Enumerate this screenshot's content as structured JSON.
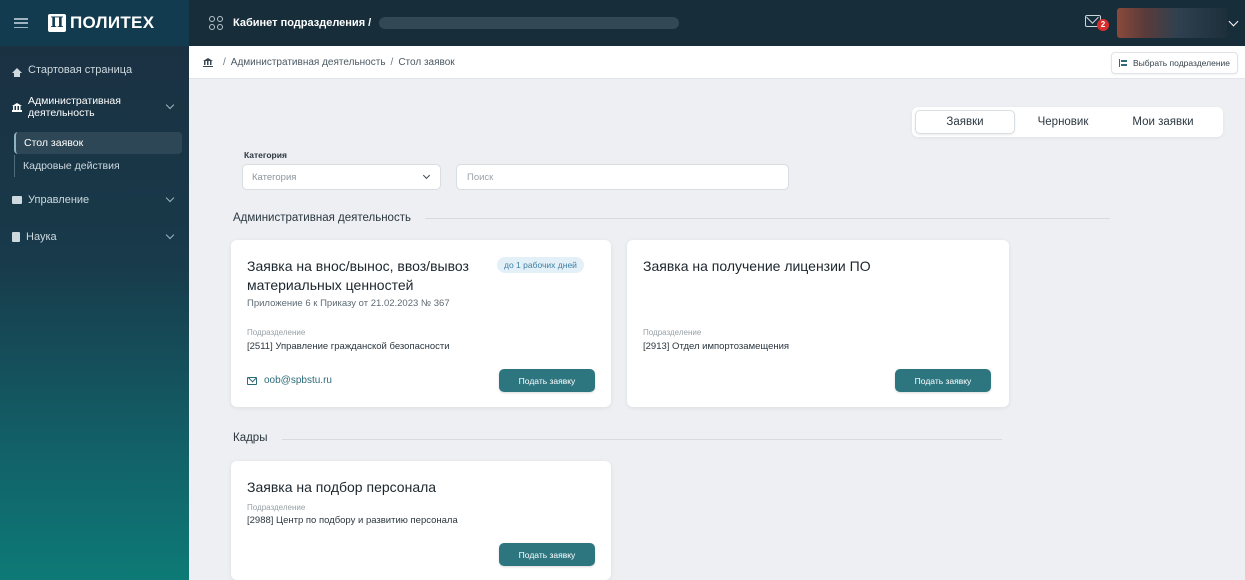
{
  "app": {
    "logo_text": "ПОЛИТЕХ",
    "logo_mark": "П",
    "cabinet_title": "Кабинет подразделения /",
    "mail_count": "2"
  },
  "sidebar": {
    "items": [
      {
        "label": "Стартовая страница",
        "icon": "home-icon"
      },
      {
        "label": "Административная деятельность",
        "icon": "bank-icon",
        "expanded": true
      },
      {
        "label": "Управление",
        "icon": "briefcase-icon"
      },
      {
        "label": "Наука",
        "icon": "book-icon"
      }
    ],
    "subitems": [
      {
        "label": "Стол заявок",
        "active": true
      },
      {
        "label": "Кадровые действия",
        "active": false
      }
    ]
  },
  "breadcrumb": {
    "items": [
      "Административная деятельность",
      "Стол заявок"
    ],
    "select_unit_label": "Выбрать подразделение"
  },
  "tabs": [
    {
      "label": "Заявки",
      "active": true
    },
    {
      "label": "Черновик",
      "active": false
    },
    {
      "label": "Мои заявки",
      "active": false
    }
  ],
  "filters": {
    "category_label": "Категория",
    "category_placeholder": "Категория",
    "search_placeholder": "Поиск"
  },
  "sections": [
    {
      "title": "Административная деятельность",
      "cards": [
        {
          "title": "Заявка на внос/вынос, ввоз/вывоз материальных ценностей",
          "subtitle": "Приложение 6 к Приказу от 21.02.2023 № 367",
          "badge": "до 1 рабочих дней",
          "unit_label": "Подразделение",
          "unit_value": "[2511] Управление гражданской безопасности",
          "email": "oob@spbstu.ru",
          "button": "Подать заявку"
        },
        {
          "title": "Заявка на получение лицензии ПО",
          "unit_label": "Подразделение",
          "unit_value": "[2913] Отдел импортозамещения",
          "button": "Подать заявку"
        }
      ]
    },
    {
      "title": "Кадры",
      "cards": [
        {
          "title": "Заявка на подбор персонала",
          "unit_label": "Подразделение",
          "unit_value": "[2988] Центр по подбору и развитию персонала",
          "button": "Подать заявку"
        }
      ]
    }
  ],
  "colors": {
    "accent": "#2d7680",
    "topbar": "#172d3a",
    "badge_red": "#d62d2d"
  }
}
